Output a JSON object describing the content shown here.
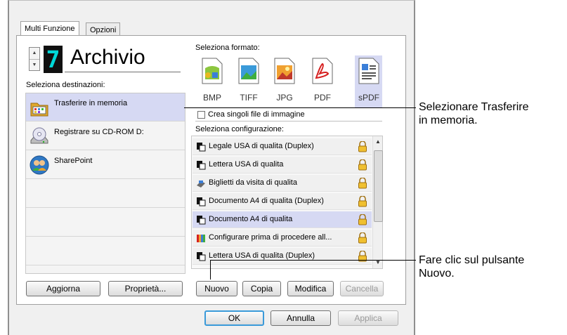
{
  "tabs": [
    {
      "label": "Multi Funzione"
    },
    {
      "label": "Opzioni"
    }
  ],
  "profile": {
    "number": "7",
    "name": "Archivio"
  },
  "destinations": {
    "heading": "Seleziona destinazioni:",
    "items": [
      {
        "label": "Trasferire in memoria",
        "icon": "memory-folder-icon"
      },
      {
        "label": "Registrare su CD-ROM  D:",
        "icon": "cd-drive-icon"
      },
      {
        "label": "SharePoint",
        "icon": "sharepoint-users-icon"
      }
    ]
  },
  "format": {
    "heading": "Seleziona formato:",
    "items": [
      {
        "label": "BMP",
        "icon": "bmp-icon"
      },
      {
        "label": "TIFF",
        "icon": "tiff-icon"
      },
      {
        "label": "JPG",
        "icon": "jpg-icon"
      },
      {
        "label": "PDF",
        "icon": "pdf-icon"
      },
      {
        "label": "sPDF",
        "icon": "spdf-icon"
      }
    ],
    "selected": "sPDF"
  },
  "single_file_checkbox": {
    "label": "Crea singoli file di immagine",
    "checked": false
  },
  "configurations": {
    "heading": "Seleziona configurazione:",
    "items": [
      {
        "label": "Legale USA di qualita (Duplex)"
      },
      {
        "label": "Lettera USA di qualita"
      },
      {
        "label": "Biglietti da visita di qualita"
      },
      {
        "label": "Documento A4 di qualita (Duplex)"
      },
      {
        "label": "Documento A4 di qualita"
      },
      {
        "label": "Configurare prima di procedere all..."
      },
      {
        "label": "Lettera USA di qualita (Duplex)"
      }
    ],
    "selected": "Documento A4 di qualita"
  },
  "buttons": {
    "aggiorna": "Aggiorna",
    "proprieta": "Proprietà...",
    "nuovo": "Nuovo",
    "copia": "Copia",
    "modifica": "Modifica",
    "cancella": "Cancella",
    "ok": "OK",
    "annulla": "Annulla",
    "applica": "Applica"
  },
  "callouts": [
    {
      "lines": [
        "Selezionare Trasferire",
        "in memoria."
      ]
    },
    {
      "lines": [
        "Fare clic sul pulsante",
        "Nuovo."
      ]
    }
  ],
  "colors": {
    "selection": "#d6d9f3",
    "digit": "#00d8d8",
    "default_button_border": "#3a9ad9"
  }
}
